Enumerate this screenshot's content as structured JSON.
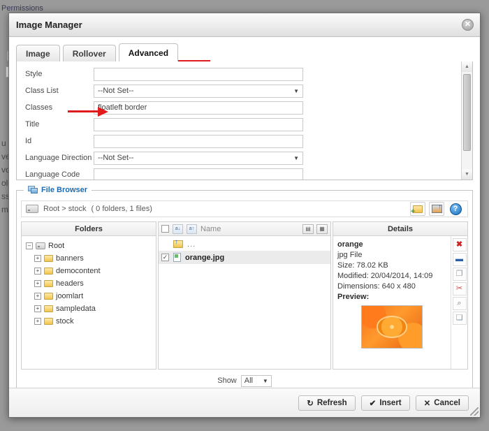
{
  "background": {
    "top_link": "Permissions",
    "side_text": [
      "u a",
      "ve",
      "vo",
      "olo",
      "ssa",
      "m,"
    ]
  },
  "modal": {
    "title": "Image Manager",
    "close_icon": "close-icon",
    "tabs": [
      {
        "label": "Image",
        "active": false
      },
      {
        "label": "Rollover",
        "active": false
      },
      {
        "label": "Advanced",
        "active": true
      }
    ],
    "form": {
      "rows": [
        {
          "label": "Style",
          "type": "text",
          "value": ""
        },
        {
          "label": "Class List",
          "type": "select",
          "value": "--Not Set--"
        },
        {
          "label": "Classes",
          "type": "text",
          "value": "floatleft  border"
        },
        {
          "label": "Title",
          "type": "text",
          "value": ""
        },
        {
          "label": "Id",
          "type": "text",
          "value": ""
        },
        {
          "label": "Language Direction",
          "type": "select",
          "value": "--Not Set--"
        },
        {
          "label": "Language Code",
          "type": "text",
          "value": ""
        }
      ],
      "scrollbar": {
        "up": "▲",
        "down": "▼"
      }
    },
    "file_browser": {
      "legend": "File Browser",
      "path": "Root > stock",
      "count": "( 0 folders, 1 files)",
      "tools": [
        {
          "name": "new-folder-icon",
          "title": ""
        },
        {
          "name": "upload-image-icon",
          "title": ""
        },
        {
          "name": "help-icon",
          "glyph": "?"
        }
      ],
      "folders_header": "Folders",
      "tree": [
        {
          "label": "Root",
          "level": 0,
          "expander": "–",
          "type": "drive"
        },
        {
          "label": "banners",
          "level": 1,
          "expander": "+",
          "type": "folder"
        },
        {
          "label": "democontent",
          "level": 1,
          "expander": "+",
          "type": "folder"
        },
        {
          "label": "headers",
          "level": 1,
          "expander": "+",
          "type": "folder"
        },
        {
          "label": "joomlart",
          "level": 1,
          "expander": "+",
          "type": "folder"
        },
        {
          "label": "sampledata",
          "level": 1,
          "expander": "+",
          "type": "folder"
        },
        {
          "label": "stock",
          "level": 1,
          "expander": "+",
          "type": "folder"
        }
      ],
      "files_header": {
        "name_label": "Name"
      },
      "files": [
        {
          "name": "...",
          "type": "parent",
          "checked": false,
          "selected": false
        },
        {
          "name": "orange.jpg",
          "type": "file",
          "checked": true,
          "selected": true
        }
      ],
      "details_header": "Details",
      "details": {
        "name": "orange",
        "kind": "jpg File",
        "size": "Size: 78.02 KB",
        "modified": "Modified: 20/04/2014, 14:09",
        "dimensions": "Dimensions: 640 x 480",
        "preview_label": "Preview:"
      },
      "actions": [
        {
          "name": "delete-icon",
          "glyph": "✖"
        },
        {
          "name": "rename-icon",
          "glyph": "▬"
        },
        {
          "name": "copy-icon",
          "glyph": "❐"
        },
        {
          "name": "cut-icon",
          "glyph": "✂"
        },
        {
          "name": "view-icon",
          "glyph": "⌕"
        },
        {
          "name": "paste-icon",
          "glyph": "❏"
        }
      ],
      "show_label": "Show",
      "show_value": "All"
    },
    "footer_buttons": [
      {
        "label": "Refresh",
        "glyph": "↻",
        "name": "refresh-button"
      },
      {
        "label": "Insert",
        "glyph": "✔",
        "name": "insert-button"
      },
      {
        "label": "Cancel",
        "glyph": "✕",
        "name": "cancel-button"
      }
    ]
  },
  "colors": {
    "annotation_red": "#e01b1b",
    "legend_blue": "#1c6bb0",
    "delete_red": "#cc2222"
  }
}
